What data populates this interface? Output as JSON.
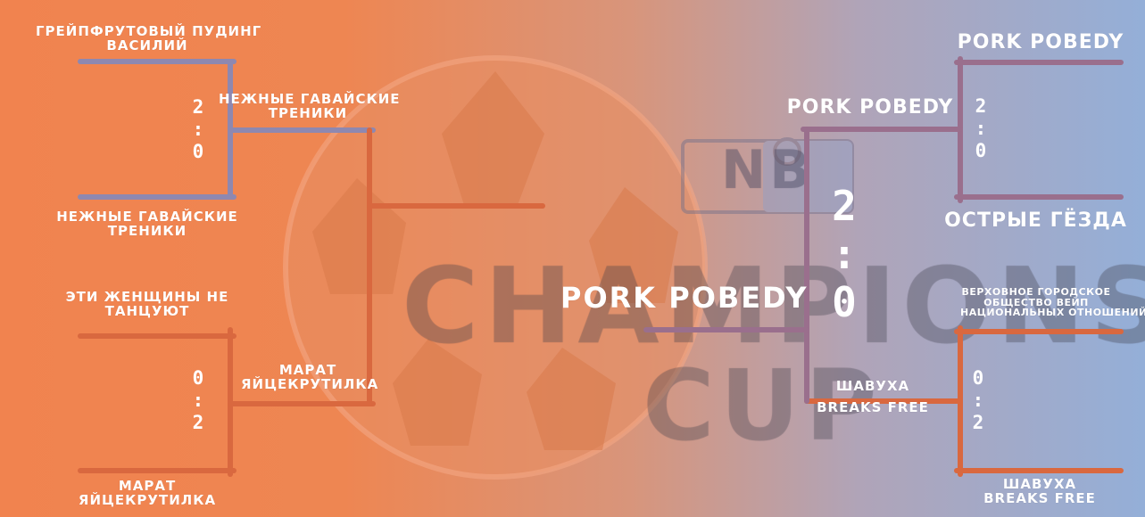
{
  "colors": {
    "orange": "#f1834f",
    "blue": "#94afd8",
    "bracket_left_line": "#8e88b0",
    "bracket_orange_line": "#d9683f",
    "bracket_right_line": "#9a6f8d",
    "text": "#ffffff"
  },
  "background": {
    "logo_badge_letters": "NB",
    "logo_word_1": "CHAMPIONS",
    "logo_word_2": "CUP"
  },
  "left_bracket": {
    "qf1": {
      "team_a": [
        "ГРЕЙПФРУТОВЫЙ ПУДИНГ",
        "ВАСИЛИЙ"
      ],
      "team_b": [
        "НЕЖНЫЕ ГАВАЙСКИЕ",
        "ТРЕНИКИ"
      ],
      "score": [
        "2",
        ":",
        "0"
      ]
    },
    "qf2": {
      "team_a": [
        "ЭТИ ЖЕНЩИНЫ НЕ",
        "ТАНЦУЮТ"
      ],
      "team_b": [
        "МАРАТ",
        "ЯЙЦЕКРУТИЛКА"
      ],
      "score": [
        "0",
        ":",
        "2"
      ]
    },
    "sf_winner_1": [
      "НЕЖНЫЕ ГАВАЙСКИЕ",
      "ТРЕНИКИ"
    ],
    "sf_winner_2": [
      "МАРАТ",
      "ЯЙЦЕКРУТИЛКА"
    ]
  },
  "right_bracket": {
    "qf1": {
      "team_a": [
        "PORK POBEDY"
      ],
      "team_b": [
        "ОСТРЫЕ ГЁЗДА"
      ],
      "score": [
        "2",
        ":",
        "0"
      ]
    },
    "qf2": {
      "team_a": [
        "ВЕРХОВНОЕ ГОРОДСКОЕ",
        "ОБЩЕСТВО ВЕЙП",
        "НАЦИОНАЛЬНЫХ ОТНОШЕНИЙ"
      ],
      "team_b": [
        "ШАВУХА",
        "BREAKS FREE"
      ],
      "score": [
        "0",
        ":",
        "2"
      ]
    },
    "sf_winner_1": [
      "PORK POBEDY"
    ],
    "sf_winner_2": [
      "ШАВУХА",
      "BREAKS FREE"
    ]
  },
  "final": {
    "champion": "PORK POBEDY",
    "score": [
      "2",
      ":",
      "0"
    ]
  }
}
